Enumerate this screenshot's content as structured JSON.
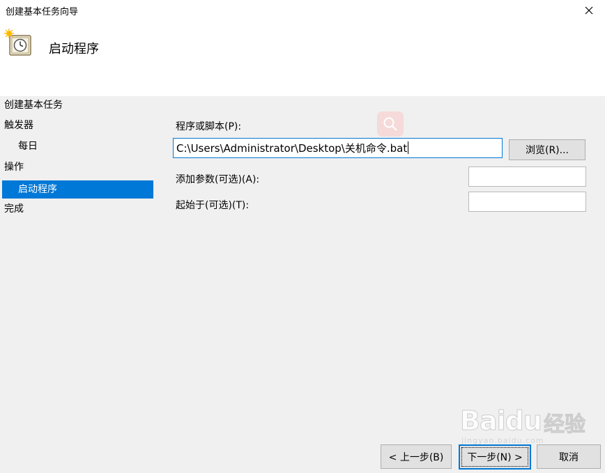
{
  "window": {
    "title": "创建基本任务向导",
    "close_label": "✕"
  },
  "header": {
    "title": "启动程序",
    "icon": "clock-icon"
  },
  "sidebar": {
    "items": [
      {
        "label": "创建基本任务",
        "level": 0,
        "selected": false
      },
      {
        "label": "触发器",
        "level": 0,
        "selected": false
      },
      {
        "label": "每日",
        "level": 1,
        "selected": false
      },
      {
        "label": "操作",
        "level": 0,
        "selected": false
      },
      {
        "label": "启动程序",
        "level": 1,
        "selected": true
      },
      {
        "label": "完成",
        "level": 0,
        "selected": false
      }
    ]
  },
  "form": {
    "program_label": "程序或脚本(P):",
    "program_value": "C:\\Users\\Administrator\\Desktop\\关机命令.bat",
    "browse_label": "浏览(R)...",
    "args_label": "添加参数(可选)(A):",
    "args_value": "",
    "start_in_label": "起始于(可选)(T):",
    "start_in_value": ""
  },
  "footer": {
    "back_label": "< 上一步(B)",
    "next_label": "下一步(N) >",
    "cancel_label": "取消"
  },
  "watermark": {
    "brand": "Baidu",
    "brand_cn": "经验",
    "url": "jingyan.baidu.com"
  },
  "colors": {
    "accent": "#0078d7",
    "window_bg": "#f0f0f0",
    "header_bg": "#ffffff"
  }
}
